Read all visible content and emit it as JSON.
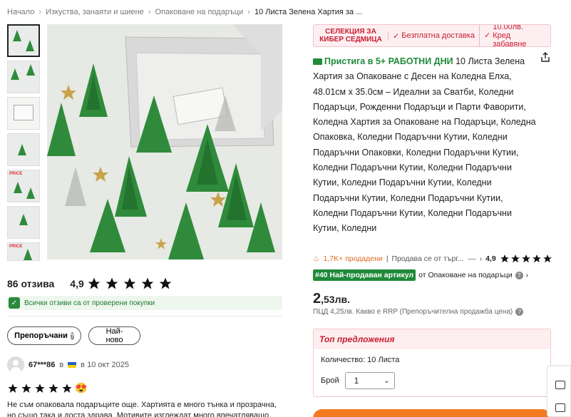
{
  "breadcrumb": {
    "items": [
      "Начало",
      "Изкуства, занаяти и шиене",
      "Опаковане на подаръци",
      "10 Листа Зелена Хартия за ..."
    ],
    "separator": "›"
  },
  "gallery": {
    "thumb_count": 7,
    "active_index": 0,
    "thumb_tags": [
      "",
      "",
      "",
      "",
      "PRICE",
      "",
      "PRICE"
    ]
  },
  "reviews": {
    "count_label": "86 отзива",
    "rating": "4,9",
    "stars": 5,
    "verified_note": "Всички отзиви са от проверени покупки",
    "filters": {
      "recommended": "Препоръчани",
      "newest": "Най-ново"
    },
    "items": [
      {
        "user": "67***86",
        "in_word": "в",
        "date": "в 10 окт 2025",
        "stars": 5,
        "emoji": "😍",
        "text": "Не съм опаковала подаръците още. Хартията е много тънка и прозрачна, но също така и доста здрава. Мотивите изглеждат много впечатляващо."
      }
    ]
  },
  "promo": {
    "title": "СЕЛЕКЦИЯ ЗА КИБЕР СЕДМИЦА",
    "free_shipping": "Безплатна доставка",
    "credit": "10.00лв. Кред забавяне"
  },
  "product": {
    "shipping": "Пристига в 5+ РАБОТНИ ДНИ",
    "title": "10 Листа Зелена Хартия за Опаковане с Десен на Коледна Елха, 48.01см x 35.0см – Идеални за Сватби, Коледни Подаръци, Рожденни Подаръци и Парти Фаворити, Коледна Хартия за Опаковане на Подаръци, Коледна Опаковка, Коледни Подаръчни Кутии, Коледни Подаръчни Опаковки, Коледни Подаръчни Кутии, Коледни Подаръчни Кутии, Коледни Подаръчни Кутии, Коледни Подаръчни Кутии, Коледни Подаръчни Кутии, Коледни Подаръчни Кутии, Коледни Подаръчни Кутии, Коледни Подаръчни Кутии, Коледни",
    "sold": "1,7K+ продадени",
    "seller": "Продава се от търг...",
    "rating": "4,9",
    "badge": "#40 Най-продаван артикул",
    "category": "от Опаковане на подаръци",
    "price_int": "2",
    "price_rest": ",53лв.",
    "rrp": "ПЦД 4,25лв. Какво е RRP (Препоръчителна продажба цена)"
  },
  "offers": {
    "title": "Топ предложения",
    "quantity": "Количество: 10 Листа",
    "count_label": "Брой",
    "count_value": "1"
  },
  "colors": {
    "accent_red": "#c81e32",
    "green": "#1f8a3a",
    "orange": "#f47a1f"
  }
}
